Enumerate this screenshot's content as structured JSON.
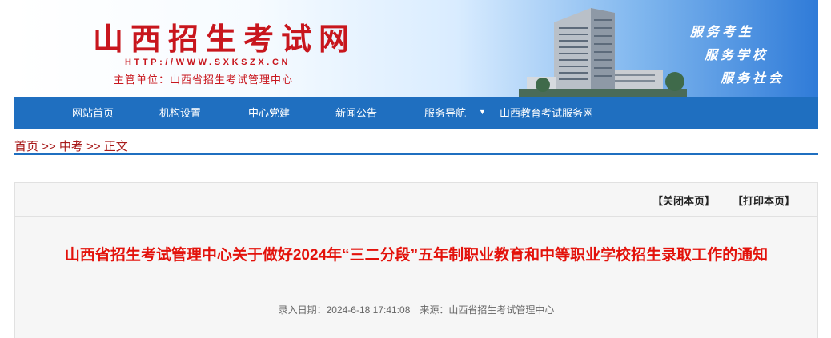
{
  "header": {
    "title": "山西招生考试网",
    "url": "HTTP://WWW.SXKSZX.CN",
    "org": "主管单位：山西省招生考试管理中心",
    "slogans": [
      "服务考生",
      "服务学校",
      "服务社会"
    ]
  },
  "nav": {
    "items": [
      "网站首页",
      "机构设置",
      "中心党建",
      "新闻公告",
      "服务导航",
      "山西教育考试服务网"
    ]
  },
  "breadcrumb": {
    "home": "首页",
    "sep1": " >> ",
    "section": "中考",
    "sep2": " >> ",
    "current": "正文"
  },
  "article": {
    "close_label": "【关闭本页】",
    "print_label": "【打印本页】",
    "title": "山西省招生考试管理中心关于做好2024年“三二分段”五年制职业教育和中等职业学校招生录取工作的通知",
    "meta": "录入日期：2024-6-18 17:41:08　来源：山西省招生考试管理中心"
  },
  "colors": {
    "brand_red": "#c8161d",
    "nav_blue": "#1f6fc0",
    "title_red": "#e3120b",
    "crumb_red": "#a81b1b"
  }
}
